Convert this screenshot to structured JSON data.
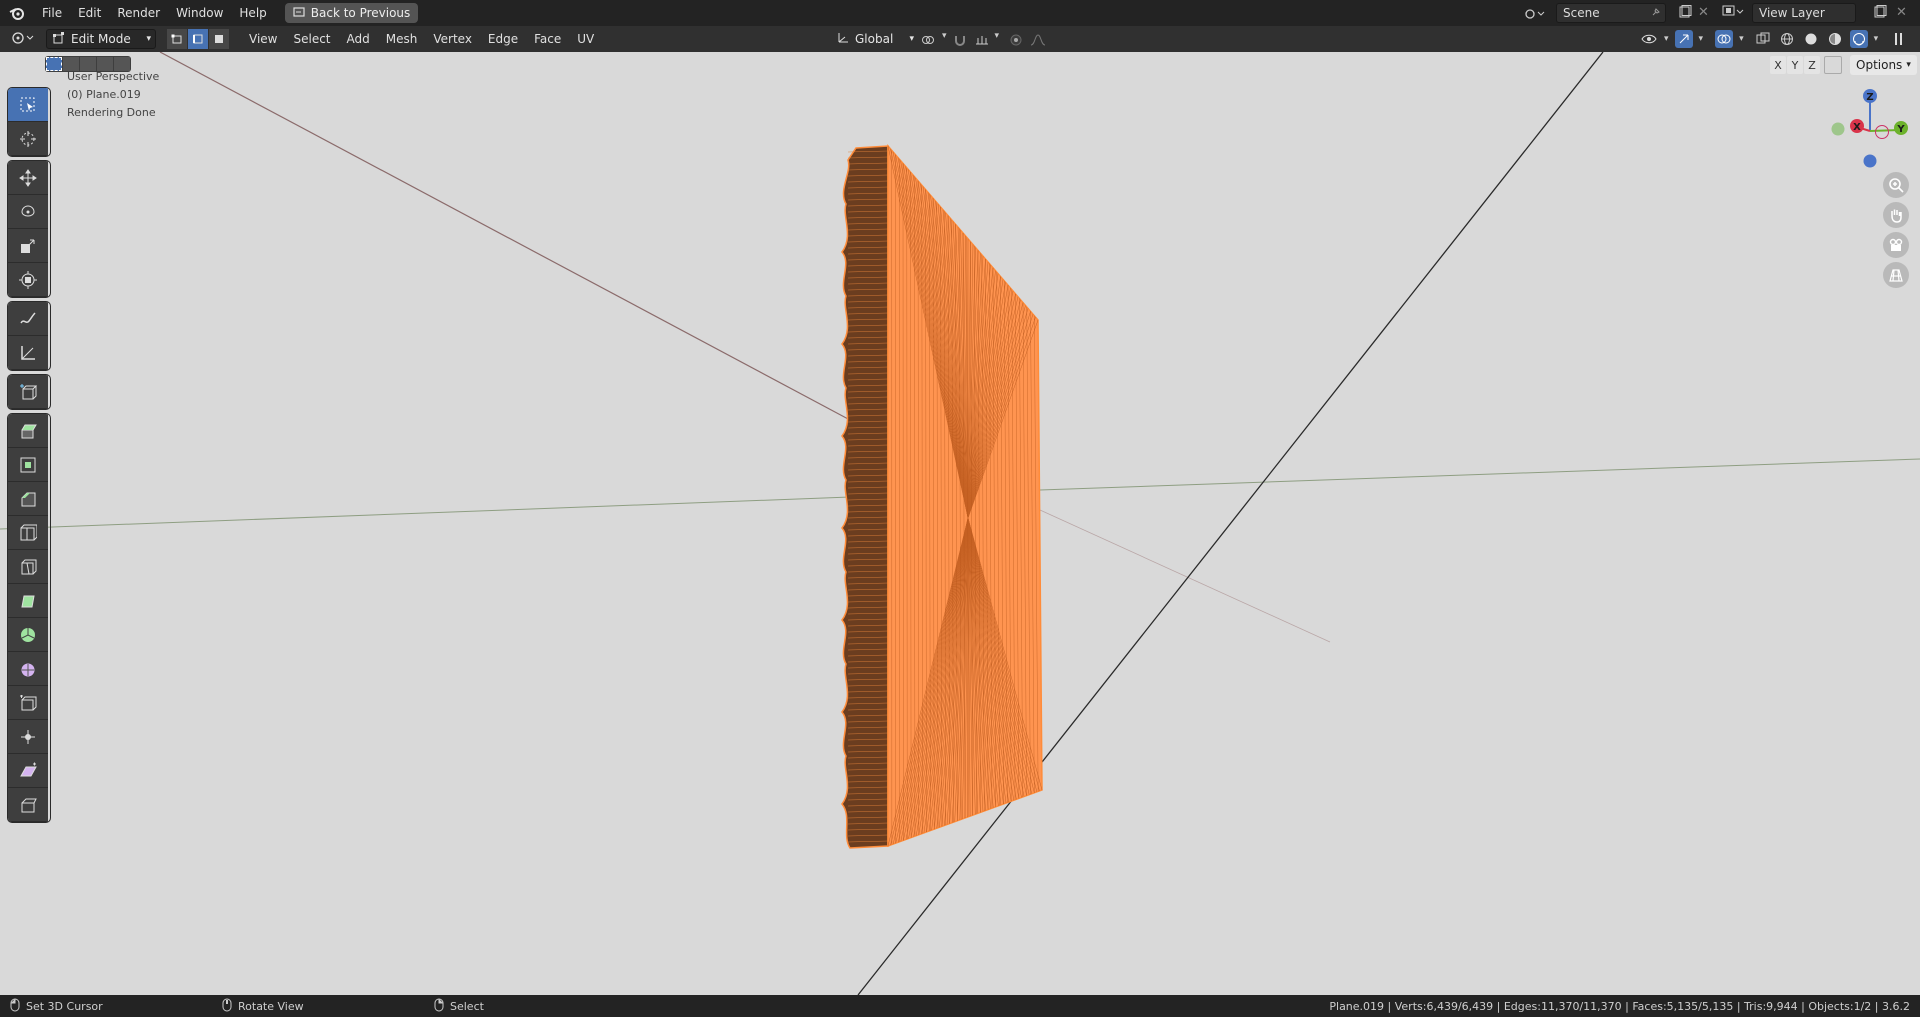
{
  "menu": {
    "items": [
      "File",
      "Edit",
      "Render",
      "Window",
      "Help"
    ],
    "back_button": "Back to Previous"
  },
  "scene": {
    "label": "Scene"
  },
  "view_layer": {
    "label": "View Layer"
  },
  "header": {
    "mode": "Edit Mode",
    "menus": [
      "View",
      "Select",
      "Add",
      "Mesh",
      "Vertex",
      "Edge",
      "Face",
      "UV"
    ],
    "transform_orientation": "Global"
  },
  "viewport": {
    "perspective": "User Perspective",
    "object": "(0) Plane.019",
    "render_status": "Rendering Done",
    "options_label": "Options",
    "axis_buttons": [
      "X",
      "Y",
      "Z"
    ],
    "gizmo": {
      "z": "Z",
      "x": "X",
      "y": "Y"
    }
  },
  "tools": [
    "select-box-icon",
    "cursor-icon",
    "move-icon",
    "rotate-icon",
    "scale-icon",
    "transform-icon",
    "annotate-icon",
    "measure-icon",
    "add-cube-icon",
    "extrude-icon",
    "inset-icon",
    "bevel-icon",
    "loop-cut-icon",
    "knife-icon",
    "poly-build-icon",
    "spin-icon",
    "smooth-icon",
    "edge-slide-icon",
    "shrink-fatten-icon",
    "shear-icon",
    "rip-icon"
  ],
  "status": {
    "left": "Set 3D Cursor",
    "middle": "Rotate View",
    "right": "Select",
    "stats": "Plane.019 | Verts:6,439/6,439 | Edges:11,370/11,370 | Faces:5,135/5,135 | Tris:9,944 | Objects:1/2 | 3.6.2"
  },
  "colors": {
    "accent": "#4772b3",
    "selected_mesh": "#ff8c3a",
    "viewport_bg": "#d9d9d9"
  }
}
